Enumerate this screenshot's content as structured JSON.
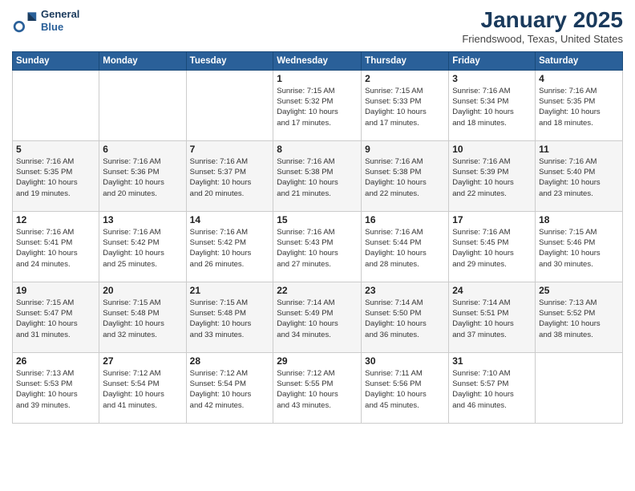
{
  "logo": {
    "line1": "General",
    "line2": "Blue"
  },
  "title": "January 2025",
  "location": "Friendswood, Texas, United States",
  "weekdays": [
    "Sunday",
    "Monday",
    "Tuesday",
    "Wednesday",
    "Thursday",
    "Friday",
    "Saturday"
  ],
  "weeks": [
    [
      {
        "day": "",
        "info": ""
      },
      {
        "day": "",
        "info": ""
      },
      {
        "day": "",
        "info": ""
      },
      {
        "day": "1",
        "info": "Sunrise: 7:15 AM\nSunset: 5:32 PM\nDaylight: 10 hours\nand 17 minutes."
      },
      {
        "day": "2",
        "info": "Sunrise: 7:15 AM\nSunset: 5:33 PM\nDaylight: 10 hours\nand 17 minutes."
      },
      {
        "day": "3",
        "info": "Sunrise: 7:16 AM\nSunset: 5:34 PM\nDaylight: 10 hours\nand 18 minutes."
      },
      {
        "day": "4",
        "info": "Sunrise: 7:16 AM\nSunset: 5:35 PM\nDaylight: 10 hours\nand 18 minutes."
      }
    ],
    [
      {
        "day": "5",
        "info": "Sunrise: 7:16 AM\nSunset: 5:35 PM\nDaylight: 10 hours\nand 19 minutes."
      },
      {
        "day": "6",
        "info": "Sunrise: 7:16 AM\nSunset: 5:36 PM\nDaylight: 10 hours\nand 20 minutes."
      },
      {
        "day": "7",
        "info": "Sunrise: 7:16 AM\nSunset: 5:37 PM\nDaylight: 10 hours\nand 20 minutes."
      },
      {
        "day": "8",
        "info": "Sunrise: 7:16 AM\nSunset: 5:38 PM\nDaylight: 10 hours\nand 21 minutes."
      },
      {
        "day": "9",
        "info": "Sunrise: 7:16 AM\nSunset: 5:38 PM\nDaylight: 10 hours\nand 22 minutes."
      },
      {
        "day": "10",
        "info": "Sunrise: 7:16 AM\nSunset: 5:39 PM\nDaylight: 10 hours\nand 22 minutes."
      },
      {
        "day": "11",
        "info": "Sunrise: 7:16 AM\nSunset: 5:40 PM\nDaylight: 10 hours\nand 23 minutes."
      }
    ],
    [
      {
        "day": "12",
        "info": "Sunrise: 7:16 AM\nSunset: 5:41 PM\nDaylight: 10 hours\nand 24 minutes."
      },
      {
        "day": "13",
        "info": "Sunrise: 7:16 AM\nSunset: 5:42 PM\nDaylight: 10 hours\nand 25 minutes."
      },
      {
        "day": "14",
        "info": "Sunrise: 7:16 AM\nSunset: 5:42 PM\nDaylight: 10 hours\nand 26 minutes."
      },
      {
        "day": "15",
        "info": "Sunrise: 7:16 AM\nSunset: 5:43 PM\nDaylight: 10 hours\nand 27 minutes."
      },
      {
        "day": "16",
        "info": "Sunrise: 7:16 AM\nSunset: 5:44 PM\nDaylight: 10 hours\nand 28 minutes."
      },
      {
        "day": "17",
        "info": "Sunrise: 7:16 AM\nSunset: 5:45 PM\nDaylight: 10 hours\nand 29 minutes."
      },
      {
        "day": "18",
        "info": "Sunrise: 7:15 AM\nSunset: 5:46 PM\nDaylight: 10 hours\nand 30 minutes."
      }
    ],
    [
      {
        "day": "19",
        "info": "Sunrise: 7:15 AM\nSunset: 5:47 PM\nDaylight: 10 hours\nand 31 minutes."
      },
      {
        "day": "20",
        "info": "Sunrise: 7:15 AM\nSunset: 5:48 PM\nDaylight: 10 hours\nand 32 minutes."
      },
      {
        "day": "21",
        "info": "Sunrise: 7:15 AM\nSunset: 5:48 PM\nDaylight: 10 hours\nand 33 minutes."
      },
      {
        "day": "22",
        "info": "Sunrise: 7:14 AM\nSunset: 5:49 PM\nDaylight: 10 hours\nand 34 minutes."
      },
      {
        "day": "23",
        "info": "Sunrise: 7:14 AM\nSunset: 5:50 PM\nDaylight: 10 hours\nand 36 minutes."
      },
      {
        "day": "24",
        "info": "Sunrise: 7:14 AM\nSunset: 5:51 PM\nDaylight: 10 hours\nand 37 minutes."
      },
      {
        "day": "25",
        "info": "Sunrise: 7:13 AM\nSunset: 5:52 PM\nDaylight: 10 hours\nand 38 minutes."
      }
    ],
    [
      {
        "day": "26",
        "info": "Sunrise: 7:13 AM\nSunset: 5:53 PM\nDaylight: 10 hours\nand 39 minutes."
      },
      {
        "day": "27",
        "info": "Sunrise: 7:12 AM\nSunset: 5:54 PM\nDaylight: 10 hours\nand 41 minutes."
      },
      {
        "day": "28",
        "info": "Sunrise: 7:12 AM\nSunset: 5:54 PM\nDaylight: 10 hours\nand 42 minutes."
      },
      {
        "day": "29",
        "info": "Sunrise: 7:12 AM\nSunset: 5:55 PM\nDaylight: 10 hours\nand 43 minutes."
      },
      {
        "day": "30",
        "info": "Sunrise: 7:11 AM\nSunset: 5:56 PM\nDaylight: 10 hours\nand 45 minutes."
      },
      {
        "day": "31",
        "info": "Sunrise: 7:10 AM\nSunset: 5:57 PM\nDaylight: 10 hours\nand 46 minutes."
      },
      {
        "day": "",
        "info": ""
      }
    ]
  ]
}
